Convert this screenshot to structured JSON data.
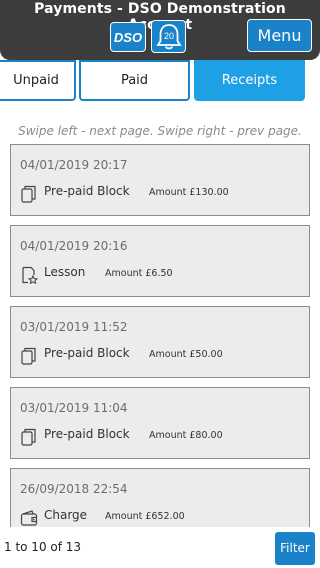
{
  "header": {
    "title": "Payments - DSO Demonstration Account",
    "logo_text": "DSO",
    "notification_count": "20",
    "menu_label": "Menu"
  },
  "tabs": [
    {
      "label": "Unpaid",
      "active": false
    },
    {
      "label": "Paid",
      "active": false
    },
    {
      "label": "Receipts",
      "active": true
    }
  ],
  "swipe_hint": "Swipe left - next page. Swipe right - prev page.",
  "receipts": [
    {
      "date": "04/01/2019 20:17",
      "type": "Pre-paid Block",
      "icon": "block-icon",
      "amount_label": "Amount",
      "amount": "£130.00"
    },
    {
      "date": "04/01/2019 20:16",
      "type": "Lesson",
      "icon": "lesson-icon",
      "amount_label": "Amount",
      "amount": "£6.50"
    },
    {
      "date": "03/01/2019 11:52",
      "type": "Pre-paid Block",
      "icon": "block-icon",
      "amount_label": "Amount",
      "amount": "£50.00"
    },
    {
      "date": "03/01/2019 11:04",
      "type": "Pre-paid Block",
      "icon": "block-icon",
      "amount_label": "Amount",
      "amount": "£80.00"
    },
    {
      "date": "26/09/2018 22:54",
      "type": "Charge",
      "icon": "wallet-icon",
      "amount_label": "Amount",
      "amount": "£652.00"
    }
  ],
  "footer": {
    "count_text": "1 to 10 of 13",
    "filter_label": "Filter"
  },
  "colors": {
    "header_bg": "#3d3d3d",
    "accent": "#1a82c8",
    "active_tab": "#1da0e6",
    "card_bg": "#ececec"
  }
}
